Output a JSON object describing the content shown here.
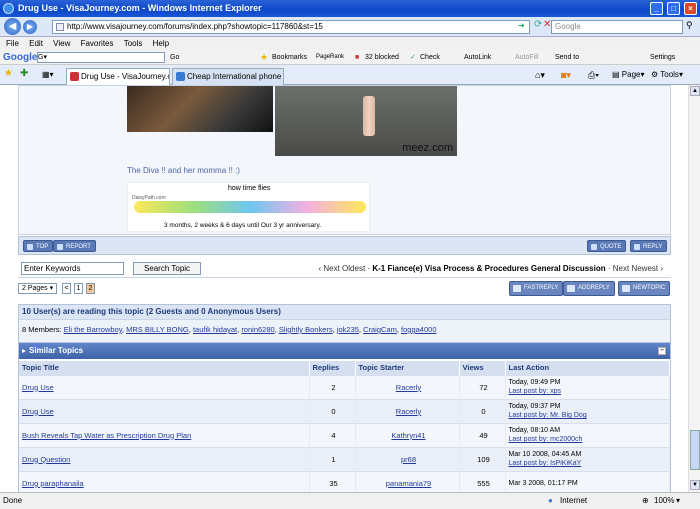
{
  "window": {
    "title": "Drug Use - VisaJourney.com - Windows Internet Explorer",
    "min": "_",
    "max": "□",
    "close": "×"
  },
  "address": {
    "url": "http://www.visajourney.com/forums/index.php?showtopic=117860&st=15",
    "search_placeholder": "Google"
  },
  "menu": [
    "File",
    "Edit",
    "View",
    "Favorites",
    "Tools",
    "Help"
  ],
  "google_toolbar": {
    "logo": "Google",
    "go": "Go",
    "bookmarks": "Bookmarks",
    "pagerank": "PageRank",
    "blocked": "32 blocked",
    "check": "Check",
    "autolink": "AutoLink",
    "autofill": "AutoFill",
    "sendto": "Send to",
    "settings": "Settings"
  },
  "tabs": [
    {
      "label": "Drug Use - VisaJourney.com"
    },
    {
      "label": "Cheap International phone calls"
    }
  ],
  "tab_tools": {
    "page": "Page",
    "tools": "Tools"
  },
  "post": {
    "caption": "The Diva !! and her momma !! :)",
    "photo_brand": "meez.com",
    "ticker_title": "how time flies",
    "ticker_site": "DaisyPath.com",
    "ticker_text": "3 months, 2 weeks & 6 days until Our 3 yr anniversary."
  },
  "post_buttons": {
    "top": "TOP",
    "report": "REPORT",
    "quote": "QUOTE",
    "reply": "REPLY"
  },
  "search": {
    "value": "Enter Keywords",
    "button": "Search Topic"
  },
  "topic_nav": {
    "prev": "‹ Next Oldest",
    "sep": "·",
    "forum": "K-1 Fiance(e) Visa Process & Procedures General Discussion",
    "sep2": "·",
    "next": "Next Newest ›"
  },
  "pagination": {
    "label": "2 Pages ▾",
    "first": "<",
    "p1": "1",
    "p2": "2"
  },
  "actions": {
    "fastreply": "FASTREPLY",
    "addreply": "ADDREPLY",
    "newtopic": "NEWTOPIC"
  },
  "readers": {
    "heading": "10 User(s) are reading this topic (2 Guests and 0 Anonymous Users)",
    "prefix": "8 Members: ",
    "members": [
      "Eli the Barrowboy",
      "MRS BILLY BONG",
      "taufik hidayat",
      "ronin6280",
      "Slightly Bonkers",
      "jok235",
      "CraigCam",
      "fogga4000"
    ]
  },
  "similar": {
    "heading": "Similar Topics",
    "headers": [
      "Topic Title",
      "Replies",
      "Topic Starter",
      "Views",
      "Last Action"
    ],
    "rows": [
      {
        "title": "Drug Use",
        "replies": "2",
        "starter": "Racerly",
        "views": "72",
        "last": "Today, 09:49 PM",
        "by": "xps"
      },
      {
        "title": "Drug Use",
        "replies": "0",
        "starter": "Racerly",
        "views": "0",
        "last": "Today, 09:37 PM",
        "by": "Mr. Big Dog"
      },
      {
        "title": "Bush Reveals Tap Water as Prescription Drug Plan",
        "replies": "4",
        "starter": "Kathryn41",
        "views": "49",
        "last": "Today, 08:10 AM",
        "by": "mc2000ch"
      },
      {
        "title": "Drug Question",
        "replies": "1",
        "starter": "pr68",
        "views": "109",
        "last": "Mar 10 2008, 04:45 AM",
        "by": "IsPiKiKaY"
      },
      {
        "title": "Drug paraphanaila",
        "replies": "35",
        "starter": "panamania79",
        "views": "555",
        "last": "Mar 3 2008, 01:17 PM",
        "by": ""
      }
    ],
    "last_post_label": "Last post by: "
  },
  "status": {
    "left": "Done",
    "zone": "Internet",
    "zoom": "100%"
  }
}
